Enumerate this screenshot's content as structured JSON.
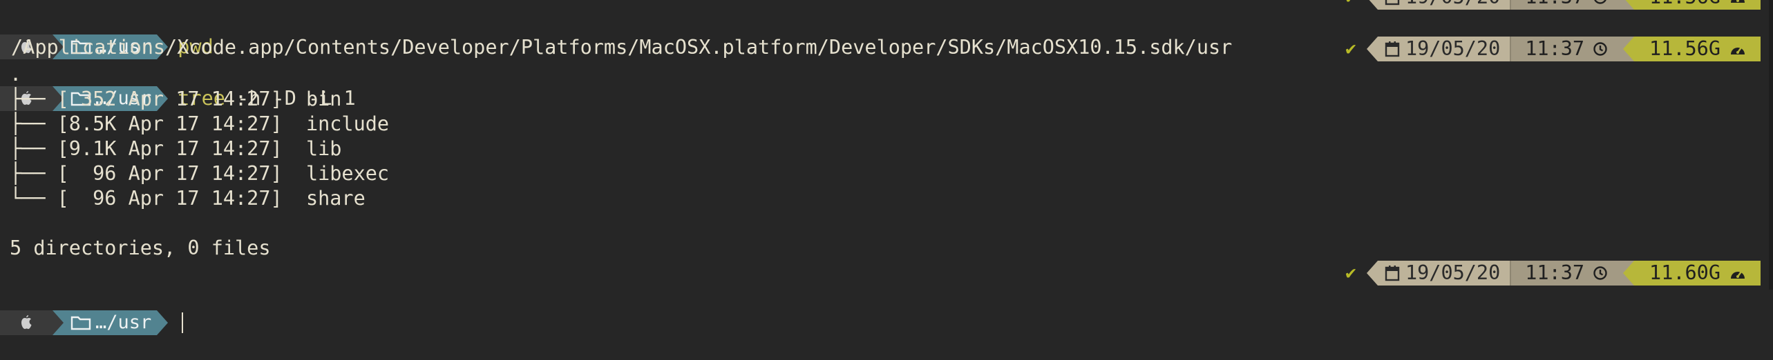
{
  "terminal": {
    "prev_prompt": {
      "path": "…/usr",
      "command": "pwd",
      "date": "19/05/20",
      "time": "11:37",
      "mem": "11.56G"
    },
    "pwd_output": "/Applications/Xcode.app/Contents/Developer/Platforms/MacOSX.platform/Developer/SDKs/MacOSX10.15.sdk/usr",
    "prompt1": {
      "path": "…/usr",
      "command": "tree",
      "args": " -h -D -L 1",
      "date": "19/05/20",
      "time": "11:37",
      "mem": "11.56G"
    },
    "tree_lines": [
      ".",
      "├── [ 352 Apr 17 14:27]  bin",
      "├── [8.5K Apr 17 14:27]  include",
      "├── [9.1K Apr 17 14:27]  lib",
      "├── [  96 Apr 17 14:27]  libexec",
      "└── [  96 Apr 17 14:27]  share"
    ],
    "summary": "5 directories, 0 files",
    "prompt2": {
      "path": "…/usr",
      "date": "19/05/20",
      "time": "11:37",
      "mem": "11.60G"
    }
  },
  "icons": {
    "apple": "apple-icon",
    "folder": "folder-icon",
    "check": "checkmark-icon",
    "calendar": "calendar-icon",
    "clock": "clock-icon",
    "gauge": "gauge-icon"
  },
  "colors": {
    "background": "#262626",
    "path_segment": "#528390",
    "date_segment": "#bdb39a",
    "time_segment": "#a39a84",
    "mem_segment": "#b7b73a",
    "command": "#c9c25a",
    "check": "#b8bb26"
  }
}
